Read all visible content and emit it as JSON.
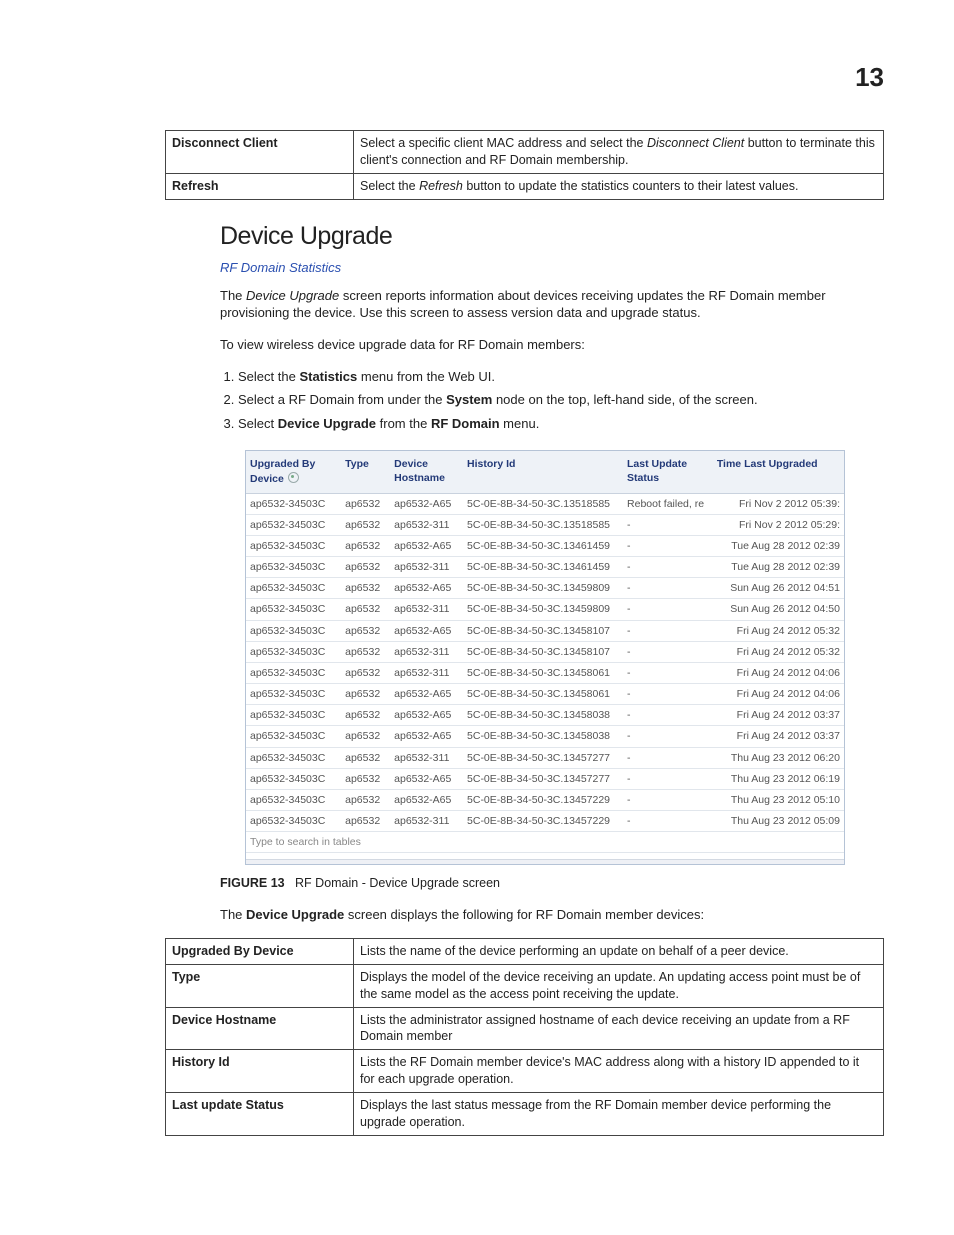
{
  "page": "13",
  "top_table": [
    {
      "term": "Disconnect Client",
      "desc_pre": "Select a specific client MAC address and select the ",
      "it": "Disconnect Client",
      "desc_post": " button to terminate this client's connection and RF Domain membership."
    },
    {
      "term": "Refresh",
      "desc_pre": "Select the ",
      "it": "Refresh",
      "desc_post": " button to update the statistics counters to their latest values."
    }
  ],
  "section_title": "Device Upgrade",
  "rf_link": "RF Domain Statistics",
  "intro_pre": "The ",
  "intro_it": "Device Upgrade",
  "intro_post": " screen reports information about devices receiving updates the RF Domain member provisioning the device. Use this screen to assess version data and upgrade status.",
  "lead": "To view wireless device upgrade data for RF Domain members:",
  "steps": [
    {
      "pre": "Select the ",
      "b": "Statistics",
      "post": " menu from the Web UI."
    },
    {
      "pre": "Select a RF Domain from under the ",
      "b": "System",
      "post": " node on the top, left-hand side, of the screen."
    },
    {
      "pre": "Select ",
      "b": "Device Upgrade",
      "mid": " from the ",
      "b2": "RF Domain",
      "post": " menu."
    }
  ],
  "ss_headers": [
    "Upgraded By Device",
    "Type",
    "Device Hostname",
    "History Id",
    "Last Update Status",
    "Time Last Upgraded"
  ],
  "ss_rows": [
    [
      "ap6532-34503C",
      "ap6532",
      "ap6532-A65",
      "5C-0E-8B-34-50-3C.13518585",
      "Reboot failed, re",
      "Fri Nov 2 2012 05:39:"
    ],
    [
      "ap6532-34503C",
      "ap6532",
      "ap6532-311",
      "5C-0E-8B-34-50-3C.13518585",
      "-",
      "Fri Nov 2 2012 05:29:"
    ],
    [
      "ap6532-34503C",
      "ap6532",
      "ap6532-A65",
      "5C-0E-8B-34-50-3C.13461459",
      "-",
      "Tue Aug 28 2012 02:39"
    ],
    [
      "ap6532-34503C",
      "ap6532",
      "ap6532-311",
      "5C-0E-8B-34-50-3C.13461459",
      "-",
      "Tue Aug 28 2012 02:39"
    ],
    [
      "ap6532-34503C",
      "ap6532",
      "ap6532-A65",
      "5C-0E-8B-34-50-3C.13459809",
      "-",
      "Sun Aug 26 2012 04:51"
    ],
    [
      "ap6532-34503C",
      "ap6532",
      "ap6532-311",
      "5C-0E-8B-34-50-3C.13459809",
      "-",
      "Sun Aug 26 2012 04:50"
    ],
    [
      "ap6532-34503C",
      "ap6532",
      "ap6532-A65",
      "5C-0E-8B-34-50-3C.13458107",
      "-",
      "Fri Aug 24 2012 05:32"
    ],
    [
      "ap6532-34503C",
      "ap6532",
      "ap6532-311",
      "5C-0E-8B-34-50-3C.13458107",
      "-",
      "Fri Aug 24 2012 05:32"
    ],
    [
      "ap6532-34503C",
      "ap6532",
      "ap6532-311",
      "5C-0E-8B-34-50-3C.13458061",
      "-",
      "Fri Aug 24 2012 04:06"
    ],
    [
      "ap6532-34503C",
      "ap6532",
      "ap6532-A65",
      "5C-0E-8B-34-50-3C.13458061",
      "-",
      "Fri Aug 24 2012 04:06"
    ],
    [
      "ap6532-34503C",
      "ap6532",
      "ap6532-A65",
      "5C-0E-8B-34-50-3C.13458038",
      "-",
      "Fri Aug 24 2012 03:37"
    ],
    [
      "ap6532-34503C",
      "ap6532",
      "ap6532-A65",
      "5C-0E-8B-34-50-3C.13458038",
      "-",
      "Fri Aug 24 2012 03:37"
    ],
    [
      "ap6532-34503C",
      "ap6532",
      "ap6532-311",
      "5C-0E-8B-34-50-3C.13457277",
      "-",
      "Thu Aug 23 2012 06:20"
    ],
    [
      "ap6532-34503C",
      "ap6532",
      "ap6532-A65",
      "5C-0E-8B-34-50-3C.13457277",
      "-",
      "Thu Aug 23 2012 06:19"
    ],
    [
      "ap6532-34503C",
      "ap6532",
      "ap6532-A65",
      "5C-0E-8B-34-50-3C.13457229",
      "-",
      "Thu Aug 23 2012 05:10"
    ],
    [
      "ap6532-34503C",
      "ap6532",
      "ap6532-311",
      "5C-0E-8B-34-50-3C.13457229",
      "-",
      "Thu Aug 23 2012 05:09"
    ]
  ],
  "ss_search": "Type to search in tables",
  "fig_label": "FIGURE 13",
  "fig_caption": "RF Domain - Device Upgrade screen",
  "post_fig_pre": "The ",
  "post_fig_b": "Device Upgrade",
  "post_fig_post": " screen displays the following for RF Domain member devices:",
  "bottom_table": [
    {
      "term": "Upgraded By Device",
      "desc": "Lists the name of the device performing an update on behalf of a peer device."
    },
    {
      "term": "Type",
      "desc": "Displays the model of the device receiving an update. An updating access point must be of the same model as the access point receiving the update."
    },
    {
      "term": "Device Hostname",
      "desc": "Lists the administrator assigned hostname of each device receiving an update from a RF Domain member"
    },
    {
      "term": "History Id",
      "desc": "Lists the RF Domain member device's MAC address along with a history ID appended to it for each upgrade operation."
    },
    {
      "term": "Last update Status",
      "desc": "Displays the last status message from the RF Domain member device performing the upgrade operation."
    }
  ]
}
